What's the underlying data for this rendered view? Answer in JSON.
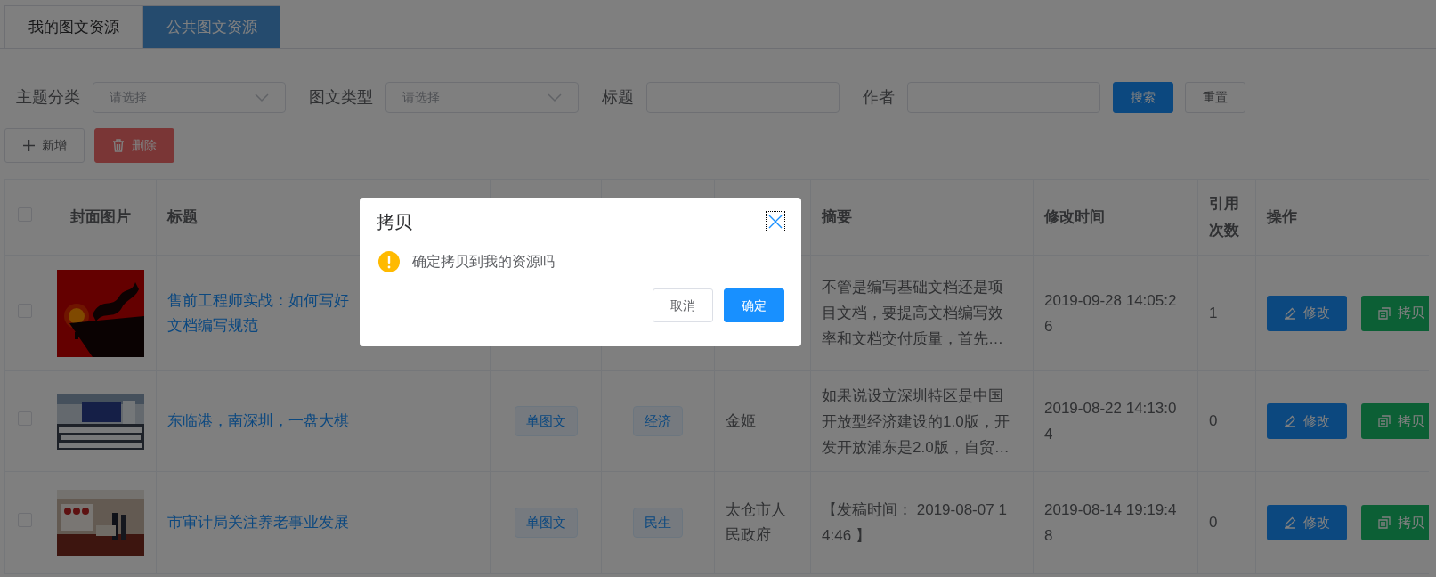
{
  "tabs": [
    {
      "label": "我的图文资源",
      "selected": false
    },
    {
      "label": "公共图文资源",
      "selected": true
    }
  ],
  "filters": [
    {
      "kind": "select",
      "label": "主题分类",
      "placeholder": "请选择"
    },
    {
      "kind": "select",
      "label": "图文类型",
      "placeholder": "请选择"
    },
    {
      "kind": "input",
      "label": "标题"
    },
    {
      "kind": "input",
      "label": "作者"
    }
  ],
  "filter_buttons": [
    {
      "kind": "primary",
      "label": "搜索"
    },
    {
      "kind": "default",
      "label": "重置"
    }
  ],
  "toolbar": [
    {
      "kind": "add",
      "label": "新增"
    },
    {
      "kind": "delete",
      "label": "删除"
    }
  ],
  "table": {
    "header": {
      "checked": false,
      "cover": "封面图片",
      "title": "标题",
      "summary": "摘要",
      "modified": "修改时间",
      "references": "引用次数",
      "actions": "操作"
    },
    "rows": [
      {
        "checked": false,
        "cover": {
          "kind": "picture"
        },
        "title": "售前工程师实战：如何写好",
        "title_line_2": "文档编写规范",
        "summary": "不管是编写基础文档还是项目文档，要提高文档编写效率和文档交付质量，首先…",
        "modified": "2019-09-28 14:05:26",
        "references": "1",
        "actions": [
          {
            "kind": "edit",
            "label": "修改"
          },
          {
            "kind": "copy",
            "label": "拷贝"
          }
        ]
      },
      {
        "checked": false,
        "cover": {
          "kind": "picture"
        },
        "title": "东临港，南深圳，一盘大棋",
        "column_4": "单图文",
        "column_5": "经济",
        "column_6": "金姬",
        "summary": "如果说设立深圳特区是中国开放型经济建设的1.0版，开发开放浦东是2.0版，自贸…",
        "modified": "2019-08-22 14:13:04",
        "references": "0",
        "actions": [
          {
            "kind": "edit",
            "label": "修改"
          },
          {
            "kind": "copy",
            "label": "拷贝"
          }
        ]
      },
      {
        "checked": false,
        "cover": {
          "kind": "picture"
        },
        "title": "市审计局关注养老事业发展",
        "column_4": "单图文",
        "column_5": "民生",
        "column_6": "太仓市人民政府",
        "summary": "【发稿时间： 2019-08-07 14:46 】",
        "modified": "2019-08-14 19:19:48",
        "references": "0",
        "actions": [
          {
            "kind": "edit",
            "label": "修改"
          },
          {
            "kind": "copy",
            "label": "拷贝"
          }
        ]
      }
    ]
  },
  "dialog": {
    "title": "拷贝",
    "message": "确定拷贝到我的资源吗",
    "buttons": [
      {
        "kind": "default",
        "label": "取消"
      },
      {
        "kind": "primary",
        "label": "确定"
      }
    ]
  }
}
